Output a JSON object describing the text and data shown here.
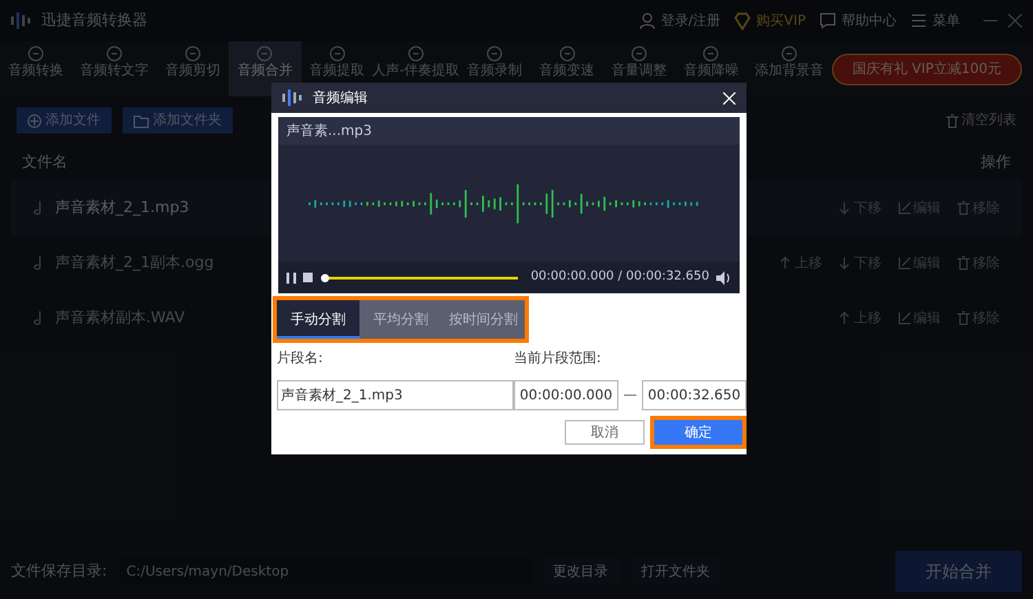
{
  "window": {
    "title": "迅捷音频转换器",
    "user_links": [
      {
        "kind": "login",
        "label": "登录/注册"
      },
      {
        "kind": "vip",
        "label": "购买VIP"
      },
      {
        "kind": "help",
        "label": "帮助中心"
      },
      {
        "kind": "menu",
        "label": "菜单"
      }
    ]
  },
  "toolbar": {
    "tools": [
      {
        "label": "音频转换",
        "selected": false
      },
      {
        "label": "音频转文字",
        "selected": false
      },
      {
        "label": "音频剪切",
        "selected": false
      },
      {
        "label": "音频合并",
        "selected": true
      },
      {
        "label": "音频提取",
        "selected": false
      },
      {
        "label": "人声-伴奏提取",
        "selected": false
      },
      {
        "label": "音频录制",
        "selected": false
      },
      {
        "label": "音频变速",
        "selected": false
      },
      {
        "label": "音量调整",
        "selected": false
      },
      {
        "label": "音频降噪",
        "selected": false
      },
      {
        "label": "添加背景音",
        "selected": false
      }
    ],
    "promo": "国庆有礼 VIP立减100元"
  },
  "file_actions": {
    "add_file": "添加文件",
    "add_folder": "添加文件夹",
    "clear_list": "清空列表"
  },
  "table": {
    "columns": [
      "文件名",
      "操作"
    ],
    "rows": [
      {
        "name": "声音素材_2_1.mp3",
        "selected": true,
        "actions": [
          {
            "kind": "down",
            "label": "下移"
          },
          {
            "kind": "edit",
            "label": "编辑"
          },
          {
            "kind": "remove",
            "label": "移除"
          }
        ]
      },
      {
        "name": "声音素材_2_1副本.ogg",
        "selected": false,
        "actions": [
          {
            "kind": "up",
            "label": "上移"
          },
          {
            "kind": "down",
            "label": "下移"
          },
          {
            "kind": "edit",
            "label": "编辑"
          },
          {
            "kind": "remove",
            "label": "移除"
          }
        ]
      },
      {
        "name": "声音素材副本.WAV",
        "selected": false,
        "actions": [
          {
            "kind": "up",
            "label": "上移"
          },
          {
            "kind": "edit",
            "label": "编辑"
          },
          {
            "kind": "remove",
            "label": "移除"
          }
        ]
      }
    ]
  },
  "status_bar": {
    "label": "文件保存目录:",
    "path": "C:/Users/mayn/Desktop",
    "change_dir": "更改目录",
    "open_folder": "打开文件夹",
    "start": "开始合并"
  },
  "dialog": {
    "title": "音频编辑",
    "player": {
      "file": "声音素...mp3",
      "level": 0,
      "time": "00:00:00.000 / 00:00:32.650"
    },
    "tabs": [
      {
        "label": "手动分割",
        "selected": true
      },
      {
        "label": "平均分割",
        "selected": false
      },
      {
        "label": "按时间分割",
        "selected": false
      }
    ],
    "tabs_highlighted": true,
    "segment_name_label": "片段名:",
    "segment_name": "声音素材_2_1.mp3",
    "range_label": "当前片段范围:",
    "range_start": "00:00:00.000",
    "range_end": "00:00:32.650",
    "cancel": "取消",
    "confirm": "确定",
    "confirm_highlighted": true
  }
}
